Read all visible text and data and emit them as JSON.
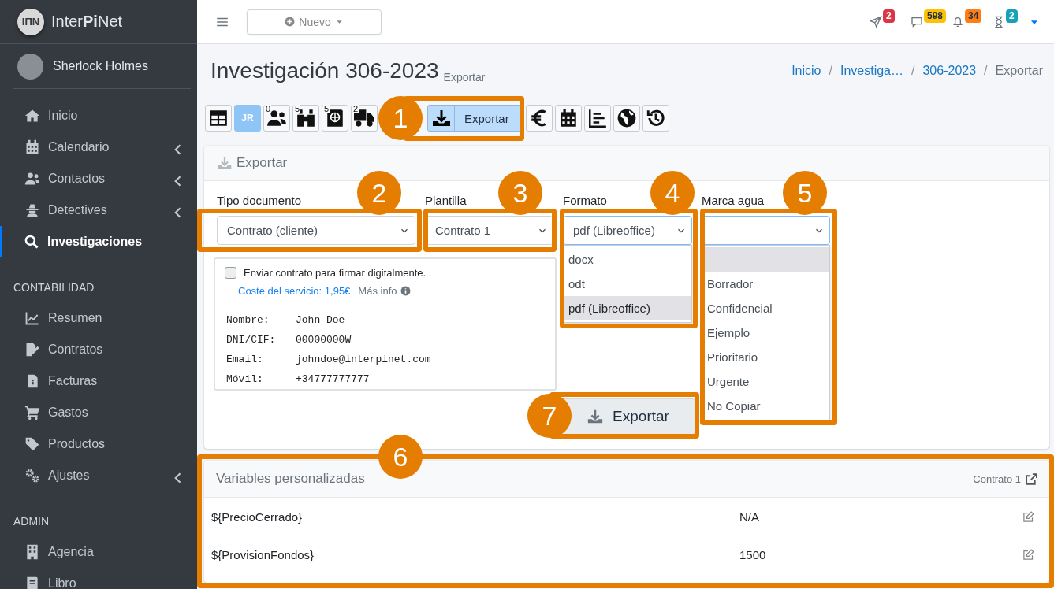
{
  "sidebar": {
    "logo": "IΠN",
    "brand": "Inter**Pi**Net",
    "user": {
      "name": "Sherlock Holmes"
    },
    "sections": [
      {
        "items": [
          {
            "label": "Inicio",
            "has_submenu": false,
            "selected": false
          },
          {
            "label": "Calendario",
            "has_submenu": true,
            "selected": false
          },
          {
            "label": "Contactos",
            "has_submenu": true,
            "selected": false
          },
          {
            "label": "Detectives",
            "has_submenu": true,
            "selected": false
          },
          {
            "label": "Investigaciones",
            "has_submenu": false,
            "selected": true
          }
        ]
      },
      {
        "header": "CONTABILIDAD",
        "items": [
          {
            "label": "Resumen",
            "has_submenu": false,
            "selected": false
          },
          {
            "label": "Contratos",
            "has_submenu": false,
            "selected": false
          },
          {
            "label": "Facturas",
            "has_submenu": false,
            "selected": false
          },
          {
            "label": "Gastos",
            "has_submenu": false,
            "selected": false
          },
          {
            "label": "Productos",
            "has_submenu": false,
            "selected": false
          },
          {
            "label": "Ajustes",
            "has_submenu": true,
            "selected": false
          }
        ]
      },
      {
        "header": "ADMIN",
        "items": [
          {
            "label": "Agencia",
            "has_submenu": false,
            "selected": false
          },
          {
            "label": "Libro",
            "has_submenu": false,
            "selected": false
          }
        ]
      }
    ]
  },
  "topbar": {
    "new_button": "Nuevo",
    "notifications": [
      {
        "count": "2",
        "color": "#dc3545"
      },
      {
        "count": "598",
        "color": "#ffc107"
      },
      {
        "count": "34",
        "color": "#fd7e14"
      },
      {
        "count": "2",
        "color": "#17a2b8"
      }
    ]
  },
  "header": {
    "title": "Investigación 306-2023",
    "subtitle": "Exportar",
    "breadcrumb": {
      "items": [
        {
          "label": "Inicio",
          "link": true
        },
        {
          "label": "Investiga…",
          "link": true
        },
        {
          "label": "306-2023",
          "link": true
        },
        {
          "label": "Exportar",
          "link": false
        }
      ],
      "separators": [
        "/",
        "/",
        "/"
      ]
    }
  },
  "toolbar": [
    {
      "kind": "icon",
      "selected": false
    },
    {
      "kind": "initials",
      "text": "JR",
      "selected": false
    },
    {
      "kind": "icon",
      "badge": "0",
      "selected": false
    },
    {
      "kind": "icon",
      "badge": "5",
      "selected": false
    },
    {
      "kind": "icon",
      "badge": "5",
      "selected": false
    },
    {
      "kind": "icon",
      "badge": "2",
      "selected": false
    },
    {
      "kind": "labeled",
      "label": "Exportar",
      "selected": true
    },
    {
      "kind": "icon",
      "selected": false
    },
    {
      "kind": "icon",
      "selected": false
    },
    {
      "kind": "icon",
      "selected": false
    },
    {
      "kind": "icon",
      "selected": false
    },
    {
      "kind": "icon",
      "selected": false
    }
  ],
  "export_card": {
    "title": "Exportar",
    "fields": [
      {
        "label": "Tipo documento",
        "value": "Contrato (cliente)",
        "open": false
      },
      {
        "label": "Plantilla",
        "value": "Contrato 1",
        "open": false
      },
      {
        "label": "Formato",
        "value": "pdf (Libreoffice)",
        "open": true,
        "options": [
          {
            "label": "docx",
            "selected": false
          },
          {
            "label": "odt",
            "selected": false
          },
          {
            "label": "pdf (Libreoffice)",
            "selected": true
          }
        ]
      },
      {
        "label": "Marca agua",
        "open": true,
        "options": [
          {
            "selected": true
          },
          {
            "label": "Borrador",
            "selected": false
          },
          {
            "label": "Confidencial",
            "selected": false
          },
          {
            "label": "Ejemplo",
            "selected": false
          },
          {
            "label": "Prioritario",
            "selected": false
          },
          {
            "label": "Urgente",
            "selected": false
          },
          {
            "label": "No Copiar",
            "selected": false
          }
        ]
      }
    ],
    "signature": {
      "checkbox": {
        "label": "Enviar contrato para firmar digitalmente.",
        "checked": false
      },
      "cost_link": "Coste del servicio: 1,95€",
      "more_info": "Más info",
      "details": [
        {
          "key": "Nombre:",
          "value": "John Doe"
        },
        {
          "key": "DNI/CIF:",
          "value": "00000000W"
        },
        {
          "key": "Email:",
          "value": "johndoe@interpinet.com"
        },
        {
          "key": "Móvil:",
          "value": "+34777777777"
        }
      ]
    },
    "export_button": "Exportar"
  },
  "variables_card": {
    "title": "Variables personalizadas",
    "template_link": "Contrato 1",
    "rows": [
      {
        "name": "${PrecioCerrado}",
        "value": "N/A"
      },
      {
        "name": "${ProvisionFondos}",
        "value": "1500"
      }
    ]
  },
  "callouts": [
    {
      "number": "1"
    },
    {
      "number": "2"
    },
    {
      "number": "3"
    },
    {
      "number": "4"
    },
    {
      "number": "5"
    },
    {
      "number": "6"
    },
    {
      "number": "7"
    }
  ]
}
